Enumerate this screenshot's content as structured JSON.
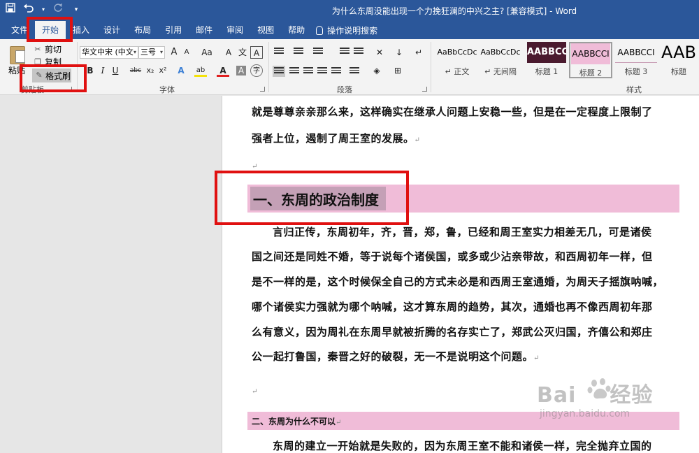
{
  "window": {
    "title": "为什么东周没能出现一个力挽狂澜的中兴之主? [兼容模式] - Word"
  },
  "qat": {
    "save": "save-icon",
    "undo": "undo-icon",
    "redo": "redo-icon"
  },
  "tabs": [
    {
      "label": "文件"
    },
    {
      "label": "开始"
    },
    {
      "label": "插入"
    },
    {
      "label": "设计"
    },
    {
      "label": "布局"
    },
    {
      "label": "引用"
    },
    {
      "label": "邮件"
    },
    {
      "label": "审阅"
    },
    {
      "label": "视图"
    },
    {
      "label": "帮助"
    }
  ],
  "tellme": "操作说明搜索",
  "clipboard": {
    "paste": "粘贴",
    "cut": "剪切",
    "copy": "复制",
    "format_painter": "格式刷",
    "group_label": "剪贴板"
  },
  "font": {
    "family": "华文中宋 (中文",
    "size": "三号",
    "grow": "A",
    "shrink": "A",
    "change_case": "Aa",
    "clear": "A",
    "phonetic": "文",
    "border": "A",
    "bold": "B",
    "italic": "I",
    "underline": "U",
    "strike": "abc",
    "subscript": "x₂",
    "superscript": "x²",
    "effects": "A",
    "highlight": "ab",
    "color": "A",
    "shading": "A",
    "enclose": "字",
    "group_label": "字体"
  },
  "paragraph": {
    "group_label": "段落"
  },
  "styles": {
    "items": [
      {
        "preview": "AaBbCcDc",
        "label": "↵ 正文"
      },
      {
        "preview": "AaBbCcDc",
        "label": "↵ 无间隔"
      },
      {
        "preview": "AABBCC",
        "label": "标题 1"
      },
      {
        "preview": "AABBCCI",
        "label": "标题 2"
      },
      {
        "preview": "AABBCCI",
        "label": "标题 3"
      },
      {
        "preview": "AAB",
        "label": "标题"
      }
    ],
    "group_label": "样式"
  },
  "document": {
    "p1_line1": "就是尊尊亲亲那么来，这样确实在继承人问题上安稳一些，但是在一定程度上限制了",
    "p1_line2": "强者上位，遏制了周王室的发展。",
    "heading1": "一、东周的政治制度",
    "p2_lines": [
      "言归正传，东周初年，齐，晋，郑，鲁，已经和周王室实力相差无几，可是诸侯",
      "国之间还是同姓不婚，等于说每个诸侯国，或多或少沾亲带故，和西周初年一样，但",
      "是不一样的是，这个时候保全自己的方式未必是和西周王室通婚，为周天子摇旗呐喊，",
      "哪个诸侯实力强就为哪个呐喊，这才算东周的趋势，其次，通婚也再不像西周初年那",
      "么有意义，因为周礼在东周早就被折腾的名存实亡了，郑武公灭归国，齐僖公和郑庄",
      "公一起打鲁国，秦晋之好的破裂，无一不是说明这个问题。"
    ],
    "heading2": "二、东周为什么不可以",
    "p3_line1": "东周的建立一开始就是失败的，因为东周王室不能和诸侯一样，完全抛弃立国的"
  },
  "watermark": {
    "brand": "Bai",
    "brand2": "经验",
    "url": "jingyan.baidu.com"
  },
  "colors": {
    "titlebar": "#2b579a",
    "heading_fill": "#f0bcd8",
    "annotation": "#e01010"
  }
}
